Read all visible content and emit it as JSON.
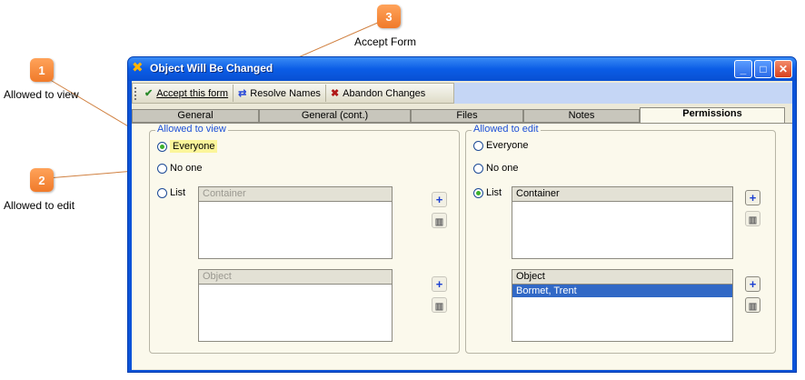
{
  "callouts": [
    {
      "num": "1",
      "label": "Allowed to view"
    },
    {
      "num": "2",
      "label": "Allowed to edit"
    },
    {
      "num": "3",
      "label": "Accept Form"
    }
  ],
  "window": {
    "title": "Object Will Be Changed",
    "minimize": "_",
    "maximize": "□",
    "close": "✕"
  },
  "toolbar": {
    "accept_label": "Accept this form",
    "accept_icon": "✔",
    "resolve_label": "Resolve Names",
    "resolve_icon": "⇄",
    "abandon_label": "Abandon Changes",
    "abandon_icon": "✖"
  },
  "tabs": [
    "General",
    "General (cont.)",
    "Files",
    "Notes",
    "Permissions"
  ],
  "view_group": {
    "legend": "Allowed to view",
    "everyone": "Everyone",
    "no_one": "No one",
    "list": "List",
    "container_header": "Container",
    "object_header": "Object"
  },
  "edit_group": {
    "legend": "Allowed to edit",
    "everyone": "Everyone",
    "no_one": "No one",
    "list": "List",
    "container_header": "Container",
    "object_header": "Object",
    "object_rows": [
      "Bormet, Trent"
    ]
  },
  "icons": {
    "add": "+",
    "delete": "🗑"
  },
  "colors": {
    "accent": "#0a53d8",
    "callout": "#f07a2a",
    "selection": "#3168c6",
    "legend": "#1c4fd6"
  }
}
